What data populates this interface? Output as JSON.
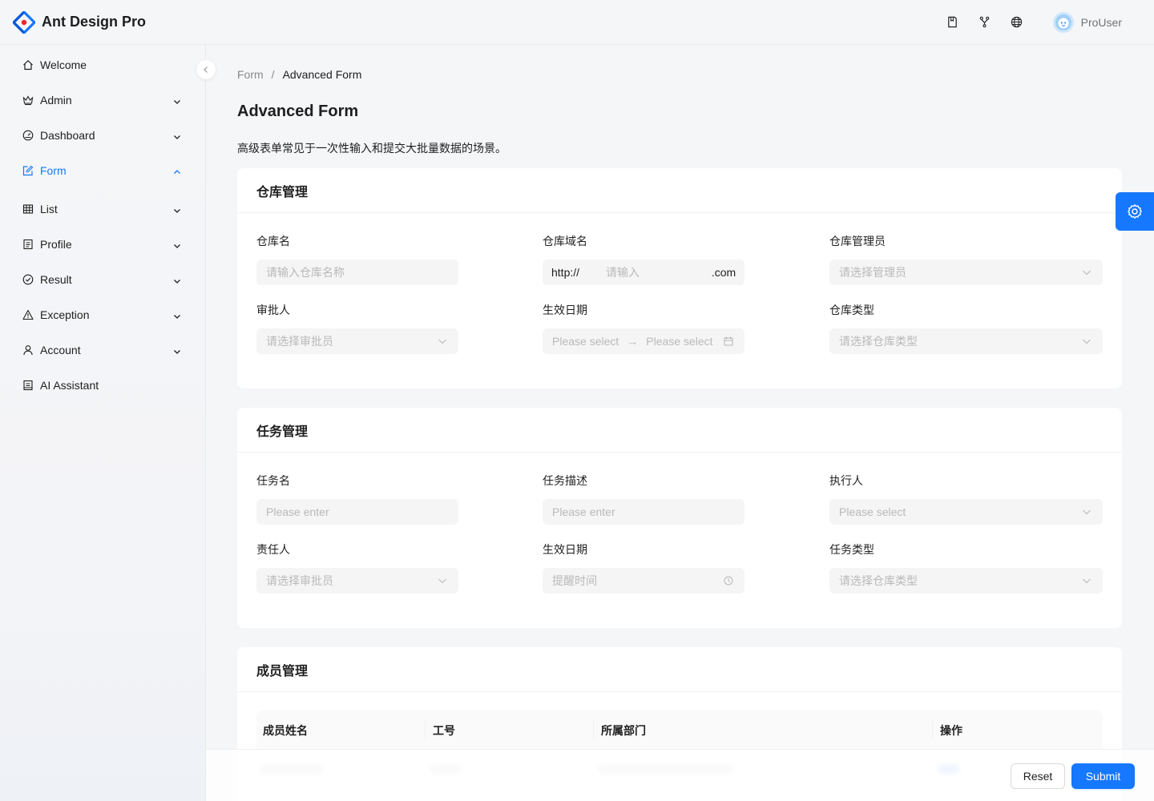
{
  "app": {
    "title": "Ant Design Pro"
  },
  "header": {
    "icons": [
      "doc-icon",
      "fork-icon",
      "globe-icon"
    ],
    "username": "ProUser"
  },
  "sidebar": {
    "items": [
      {
        "label": "Welcome",
        "icon": "home-icon",
        "has_arrow": false,
        "active": false
      },
      {
        "label": "Admin",
        "icon": "crown-icon",
        "has_arrow": true,
        "active": false
      },
      {
        "label": "Dashboard",
        "icon": "dashboard-icon",
        "has_arrow": true,
        "active": false
      },
      {
        "label": "Form",
        "icon": "form-icon",
        "has_arrow": true,
        "active": true
      },
      {
        "label": "List",
        "icon": "table-icon",
        "has_arrow": true,
        "active": false
      },
      {
        "label": "Profile",
        "icon": "profile-icon",
        "has_arrow": true,
        "active": false
      },
      {
        "label": "Result",
        "icon": "check-circle-icon",
        "has_arrow": true,
        "active": false
      },
      {
        "label": "Exception",
        "icon": "warning-icon",
        "has_arrow": true,
        "active": false
      },
      {
        "label": "Account",
        "icon": "user-icon",
        "has_arrow": true,
        "active": false
      },
      {
        "label": "AI Assistant",
        "icon": "robot-icon",
        "has_arrow": false,
        "active": false
      }
    ]
  },
  "breadcrumb": {
    "prev": "Form",
    "sep": "/",
    "current": "Advanced Form"
  },
  "page": {
    "title": "Advanced Form",
    "description": "高级表单常见于一次性输入和提交大批量数据的场景。"
  },
  "warehouse": {
    "title": "仓库管理",
    "name_label": "仓库名",
    "name_placeholder": "请输入仓库名称",
    "domain_label": "仓库域名",
    "domain_prefix": "http://",
    "domain_placeholder": "请输入",
    "domain_suffix": ".com",
    "manager_label": "仓库管理员",
    "manager_placeholder": "请选择管理员",
    "approver_label": "审批人",
    "approver_placeholder": "请选择审批员",
    "date_label": "生效日期",
    "date_start_placeholder": "Please select",
    "date_end_placeholder": "Please select",
    "date_arrow": "→",
    "type_label": "仓库类型",
    "type_placeholder": "请选择仓库类型"
  },
  "task": {
    "title": "任务管理",
    "name_label": "任务名",
    "name_placeholder": "Please enter",
    "desc_label": "任务描述",
    "desc_placeholder": "Please enter",
    "executor_label": "执行人",
    "executor_placeholder": "Please select",
    "owner_label": "责任人",
    "owner_placeholder": "请选择审批员",
    "date_label": "生效日期",
    "date_placeholder": "提醒时间",
    "type_label": "任务类型",
    "type_placeholder": "请选择仓库类型"
  },
  "members": {
    "title": "成员管理",
    "columns": [
      "成员姓名",
      "工号",
      "所属部门",
      "操作"
    ]
  },
  "footer": {
    "reset_label": "Reset",
    "submit_label": "Submit"
  },
  "colors": {
    "primary": "#1677ff",
    "bg": "#f5f6f8"
  }
}
